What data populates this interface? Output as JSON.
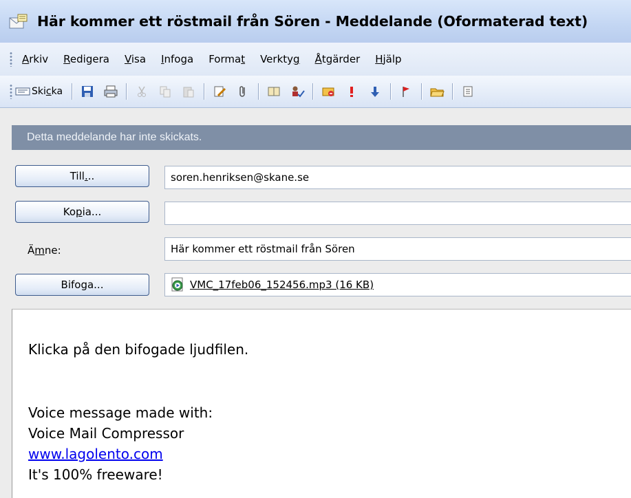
{
  "window": {
    "title": "Här kommer ett röstmail från Sören - Meddelande (Oformaterad text)",
    "icon": "message-envelope-icon"
  },
  "menubar": {
    "items": [
      {
        "label": "Arkiv",
        "accel": "A",
        "rest": "rkiv"
      },
      {
        "label": "Redigera",
        "accel": "R",
        "rest": "edigera"
      },
      {
        "label": "Visa",
        "accel": "V",
        "rest": "isa"
      },
      {
        "label": "Infoga",
        "accel": "I",
        "rest": "nfoga"
      },
      {
        "label": "Format",
        "pre": "Forma",
        "accel": "t"
      },
      {
        "label": "Verktyg",
        "pre": "Verkty",
        "accel": "g"
      },
      {
        "label": "Åtgärder",
        "accel": "Å",
        "rest": "tgärder"
      },
      {
        "label": "Hjälp",
        "accel": "H",
        "rest": "jälp"
      }
    ]
  },
  "toolbar": {
    "send": {
      "pre": "Ski",
      "accel": "c",
      "rest": "ka"
    },
    "icons": [
      "save-icon",
      "print-icon",
      "cut-icon",
      "copy-icon",
      "paste-icon",
      "edit-icon",
      "paperclip-icon",
      "address-book-icon",
      "check-names-icon",
      "options-icon",
      "importance-high-icon",
      "importance-low-icon",
      "flag-icon",
      "open-folder-icon",
      "more-icon"
    ]
  },
  "infobar": {
    "text": "Detta meddelande har inte skickats."
  },
  "header": {
    "to": {
      "pre": "Till",
      "accel": ".",
      "rest": "..",
      "value": "soren.henriksen@skane.se"
    },
    "cc": {
      "pre": "Ko",
      "accel": "p",
      "rest": "ia...",
      "value": ""
    },
    "subject": {
      "pre": "Ä",
      "accel": "m",
      "rest": "ne:",
      "value": "Här kommer ett röstmail från Sören"
    },
    "attach": {
      "label": "Bifoga...",
      "file": "VMC_17feb06_152456.mp3 (16 KB)"
    }
  },
  "body": {
    "line1": "Klicka på den bifogade ljudfilen.",
    "line2": "Voice message made with:",
    "line3": "Voice Mail Compressor",
    "link": "www.lagolento.com",
    "line5": "It's 100% freeware!"
  },
  "colors": {
    "infobar_bg": "#7f8fa6",
    "link": "#0000ee"
  }
}
